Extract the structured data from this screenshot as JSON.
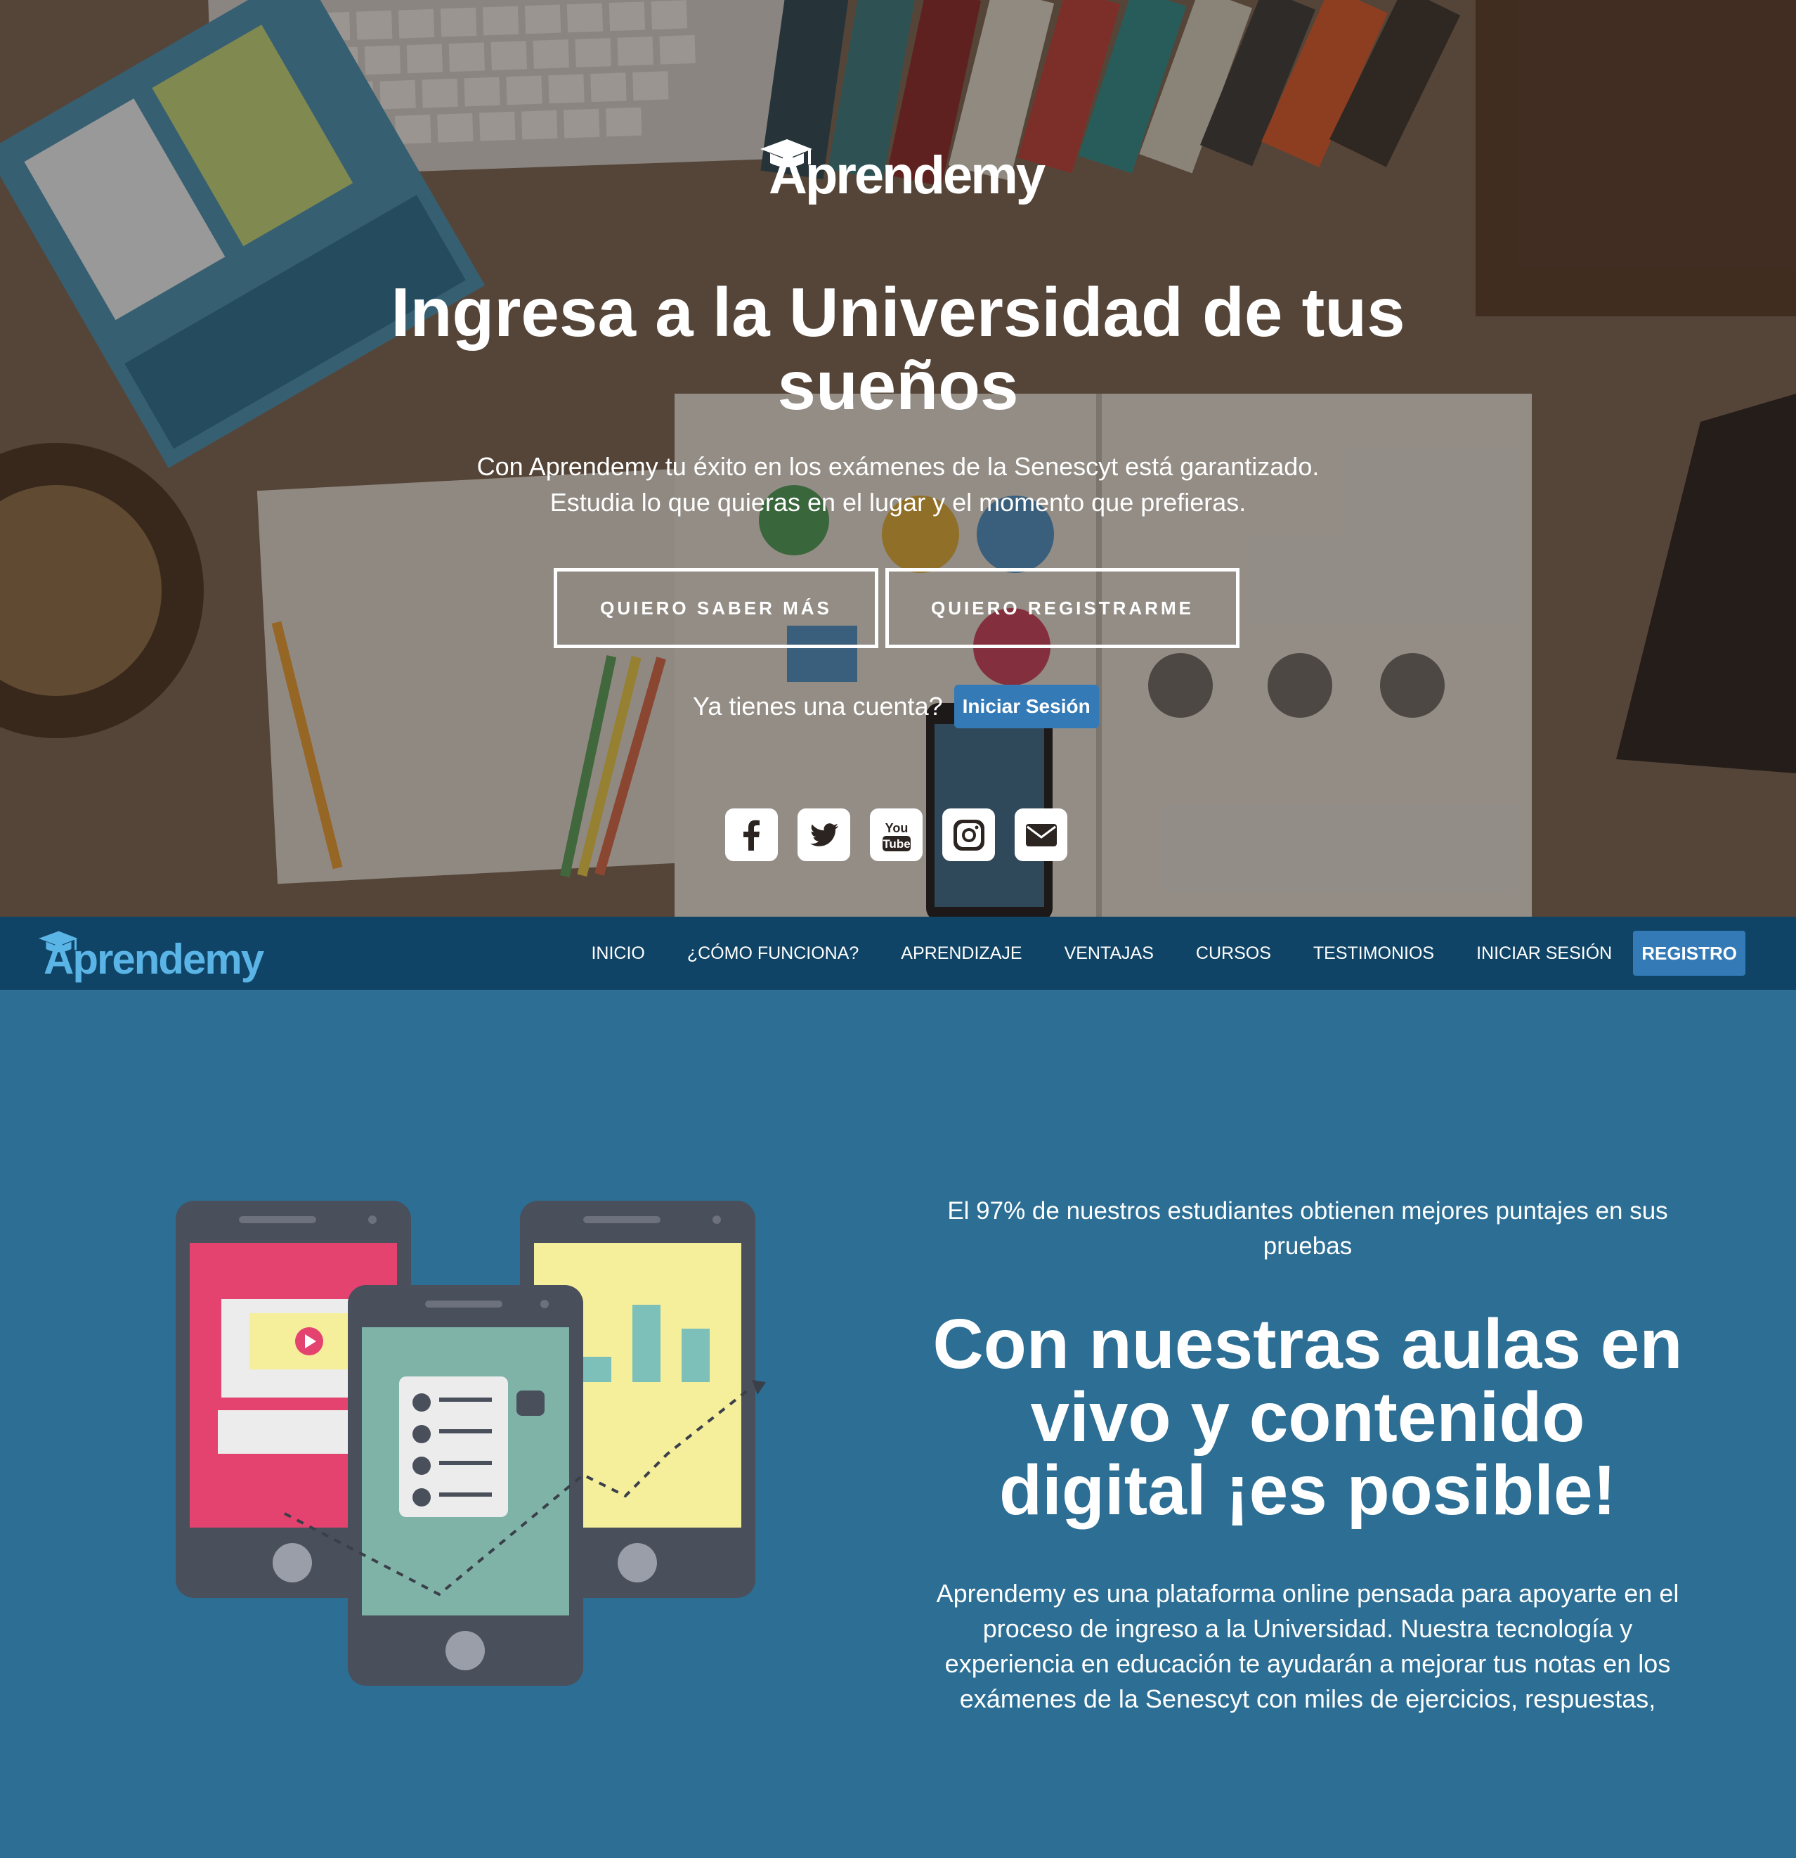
{
  "brand": {
    "name": "Aprendemy"
  },
  "hero": {
    "title": "Ingresa a la Universidad de tus sueños",
    "subtitle_line1": "Con Aprendemy tu éxito en los exámenes de la Senescyt está garantizado.",
    "subtitle_line2": "Estudia lo que quieras en el lugar y el momento que prefieras.",
    "btn_more": "QUIERO SABER MÁS",
    "btn_register": "QUIERO REGISTRARME",
    "account_question": "Ya tienes una cuenta?",
    "login_button": "Iniciar Sesión",
    "social_icons": [
      "facebook-icon",
      "twitter-icon",
      "youtube-icon",
      "instagram-icon",
      "email-icon"
    ],
    "youtube_you": "You",
    "youtube_tube": "Tube"
  },
  "nav": {
    "items": [
      {
        "label": "INICIO"
      },
      {
        "label": "¿CÓMO FUNCIONA?"
      },
      {
        "label": "APRENDIZAJE"
      },
      {
        "label": "VENTAJAS"
      },
      {
        "label": "CURSOS"
      },
      {
        "label": "TESTIMONIOS"
      },
      {
        "label": "INICIAR SESIÓN"
      }
    ],
    "register": "REGISTRO"
  },
  "feature": {
    "lead": "El 97% de nuestros estudiantes obtienen mejores puntajes en sus pruebas",
    "title": "Con nuestras aulas en vivo y contenido digital ¡es posible!",
    "body": "Aprendemy es una plataforma online pensada para apoyarte en el proceso de ingreso a la Universidad. Nuestra tecnología y experiencia en educación te ayudarán a mejorar tus notas en los exámenes de la Senescyt con miles de ejercicios, respuestas,"
  },
  "colors": {
    "nav_bg": "#0f4466",
    "section_bg": "#2c6e94",
    "primary_button": "#337ab7",
    "nav_logo": "#5ab4e5"
  }
}
